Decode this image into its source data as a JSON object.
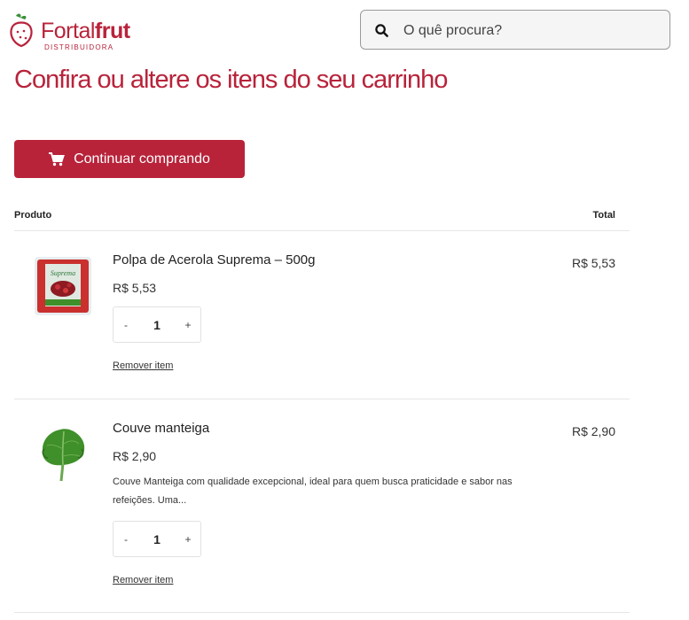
{
  "logo": {
    "part1": "Fortal",
    "part2": "frut",
    "subtitle": "DISTRIBUIDORA"
  },
  "search": {
    "placeholder": "O quê procura?"
  },
  "page_title": "Confira ou altere os itens do seu carrinho",
  "continue_button": {
    "label": "Continuar comprando"
  },
  "table": {
    "col_product": "Produto",
    "col_total": "Total"
  },
  "items": [
    {
      "name": "Polpa de Acerola Suprema – 500g",
      "price": "R$ 5,53",
      "total": "R$ 5,53",
      "quantity": "1",
      "minus": "-",
      "plus": "+",
      "remove": "Remover item",
      "package_text": "Suprema"
    },
    {
      "name": "Couve manteiga",
      "price": "R$ 2,90",
      "total": "R$ 2,90",
      "description": "Couve Manteiga com qualidade excepcional, ideal para quem busca praticidade e sabor nas refeições. Uma...",
      "quantity": "1",
      "minus": "-",
      "plus": "+",
      "remove": "Remover item"
    }
  ],
  "colors": {
    "brand": "#b8233a",
    "leaf": "#3f8f2a"
  }
}
